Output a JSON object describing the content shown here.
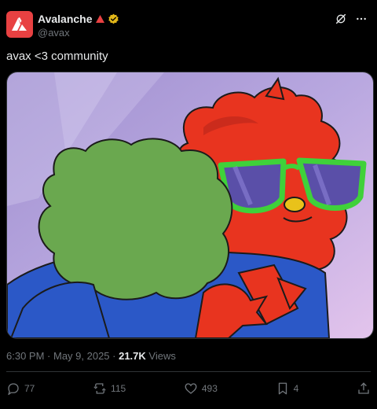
{
  "author": {
    "display_name": "Avalanche",
    "handle": "@avax",
    "verified_icon": "gold-verified-badge",
    "brand_color": "#e84142"
  },
  "tweet": {
    "text": "avax <3 community"
  },
  "meta": {
    "time": "6:30 PM",
    "separator": " · ",
    "date": "May 9, 2025",
    "views_count": "21.7K",
    "views_label": "Views"
  },
  "actions": {
    "replies": "77",
    "reposts": "115",
    "likes": "493",
    "bookmarks": "4"
  },
  "icons": [
    "avalanche-logo-icon",
    "red-triangle-icon",
    "verified-badge-icon",
    "grok-icon",
    "more-icon",
    "reply-icon",
    "repost-icon",
    "like-icon",
    "bookmark-icon",
    "share-icon"
  ]
}
